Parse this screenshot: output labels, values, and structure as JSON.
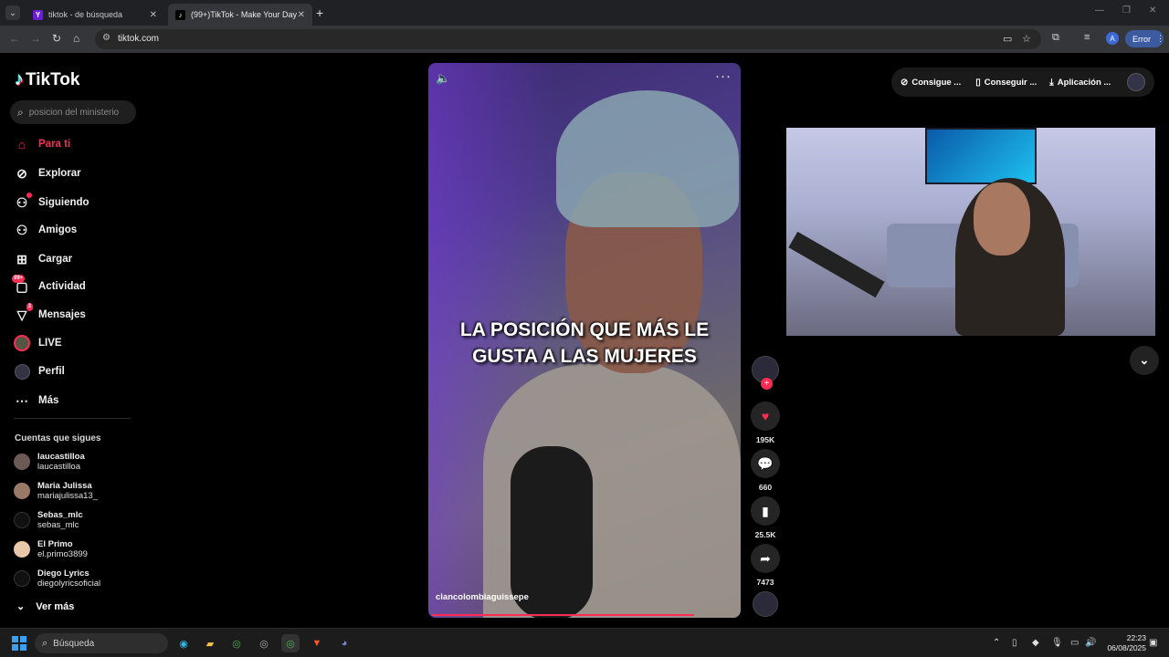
{
  "browser": {
    "tabs": [
      {
        "title": "tiktok - de búsqueda",
        "favicon": "Y"
      },
      {
        "title": "(99+)TikTok - Make Your Day",
        "favicon": "♪"
      }
    ],
    "url": "tiktok.com",
    "error_label": "Error",
    "profile_initial": "A"
  },
  "sidebar": {
    "logo": "TikTok",
    "search_placeholder": "posicion del ministerio",
    "nav": [
      {
        "label": "Para ti",
        "icon": "home-icon"
      },
      {
        "label": "Explorar",
        "icon": "compass-icon"
      },
      {
        "label": "Siguiendo",
        "icon": "following-icon"
      },
      {
        "label": "Amigos",
        "icon": "friends-icon"
      },
      {
        "label": "Cargar",
        "icon": "upload-icon"
      },
      {
        "label": "Actividad",
        "icon": "inbox-icon",
        "badge": "99+"
      },
      {
        "label": "Mensajes",
        "icon": "message-icon",
        "badge": "3"
      },
      {
        "label": "LIVE",
        "icon": "live-icon"
      },
      {
        "label": "Perfil",
        "icon": "profile-icon"
      },
      {
        "label": "Más",
        "icon": "more-icon"
      }
    ],
    "following_header": "Cuentas que sigues",
    "following": [
      {
        "name": "laucastilloa",
        "handle": "laucastilloa"
      },
      {
        "name": "Maria Julissa",
        "handle": "mariajulissa13_"
      },
      {
        "name": "Sebas_mlc",
        "handle": "sebas_mlc"
      },
      {
        "name": "El Primo",
        "handle": "el.primo3899"
      },
      {
        "name": "Diego Lyrics",
        "handle": "diegolyricsoficial"
      }
    ],
    "see_more": "Ver más"
  },
  "video": {
    "caption_line1": "LA POSICIÓN QUE MÁS LE",
    "caption_line2": "GUSTA A LAS MUJERES",
    "author": "clancolombiaguissepe",
    "progress": 0.86
  },
  "actions": {
    "likes": "195K",
    "comments": "660",
    "saves": "25.5K",
    "shares": "7473"
  },
  "top_buttons": {
    "coins": "Consigue ...",
    "get_app": "Conseguir ...",
    "app": "Aplicación ..."
  },
  "taskbar": {
    "search_label": "Búsqueda",
    "time": "22:23",
    "date": "06/08/2025"
  },
  "colors": {
    "accent": "#fe2c55",
    "background": "#000000",
    "browser_chrome": "#35363a"
  }
}
